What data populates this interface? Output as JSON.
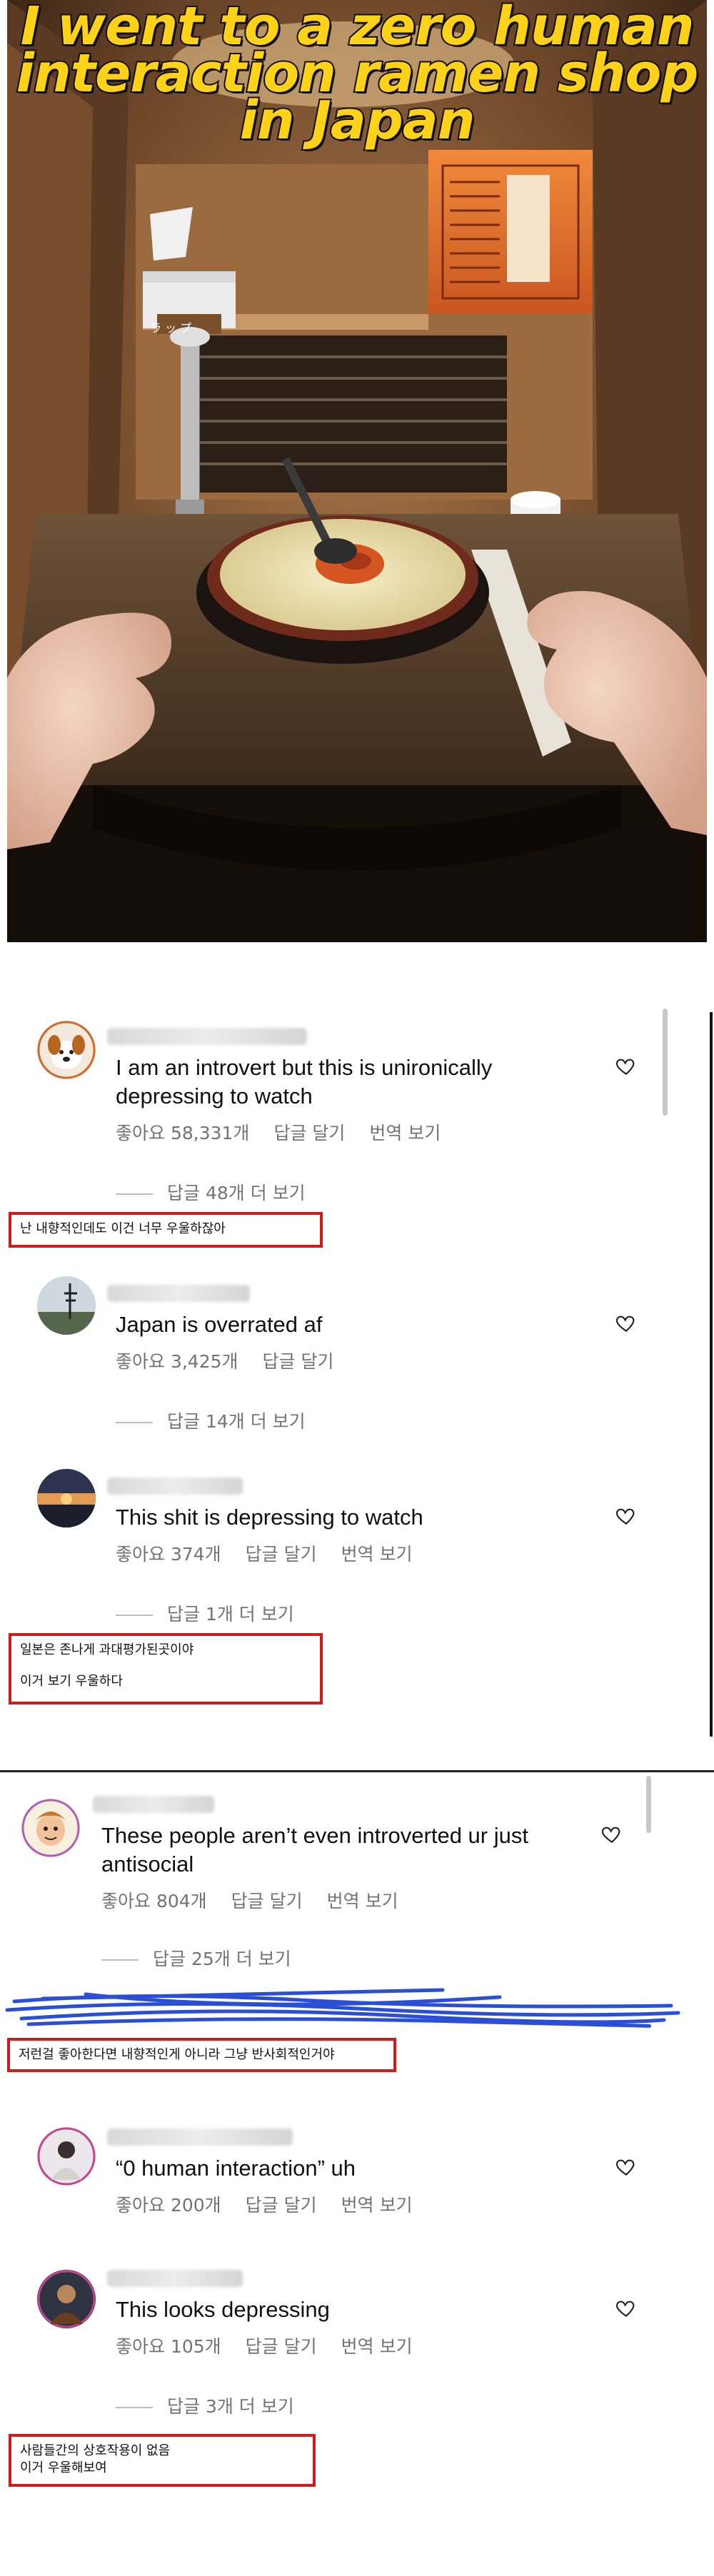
{
  "video": {
    "title_lines": [
      "I went to a zero human",
      "interaction ramen shop",
      "in Japan"
    ],
    "tissue_label": "ラ ッ プ",
    "title_color": "#ffd21a"
  },
  "comments": [
    {
      "text": "I am an introvert but this is unironically depressing to watch",
      "likes": "좋아요 58,331개",
      "reply": "답글 달기",
      "translate": "번역 보기",
      "more_replies": "답글 48개 더 보기"
    },
    {
      "text": "Japan is overrated af",
      "likes": "좋아요 3,425개",
      "reply": "답글 달기",
      "more_replies": "답글 14개 더 보기"
    },
    {
      "text": "This shit is depressing to watch",
      "likes": "좋아요 374개",
      "reply": "답글 달기",
      "translate": "번역 보기",
      "more_replies": "답글 1개 더 보기"
    },
    {
      "text": "These people aren’t even introverted ur just antisocial",
      "likes": "좋아요 804개",
      "reply": "답글 달기",
      "translate": "번역 보기",
      "more_replies": "답글 25개 더 보기"
    },
    {
      "text": "“0 human interaction” uh",
      "likes": "좋아요 200개",
      "reply": "답글 달기",
      "translate": "번역 보기"
    },
    {
      "text": "This looks depressing",
      "likes": "좋아요 105개",
      "reply": "답글 달기",
      "translate": "번역 보기",
      "more_replies": "답글 3개 더 보기"
    }
  ],
  "translations": {
    "t1": "난 내향적인데도 이건 너무 우울하잖아",
    "t2_line1": "일본은 존나게 과대평가된곳이야",
    "t2_line2": "이거 보기 우울하다",
    "t3": "저런걸 좋아한다면 내향적인게 아니라 그냥 반사회적인거야",
    "t4_line1": "사람들간의 상호작용이 없음",
    "t4_line2": "이거 우울해보여"
  },
  "colors": {
    "annotation_border": "#d11a1a",
    "scribble": "#2a4fd6",
    "meta_text": "#737373"
  },
  "icons": [
    "heart-outline-icon"
  ]
}
